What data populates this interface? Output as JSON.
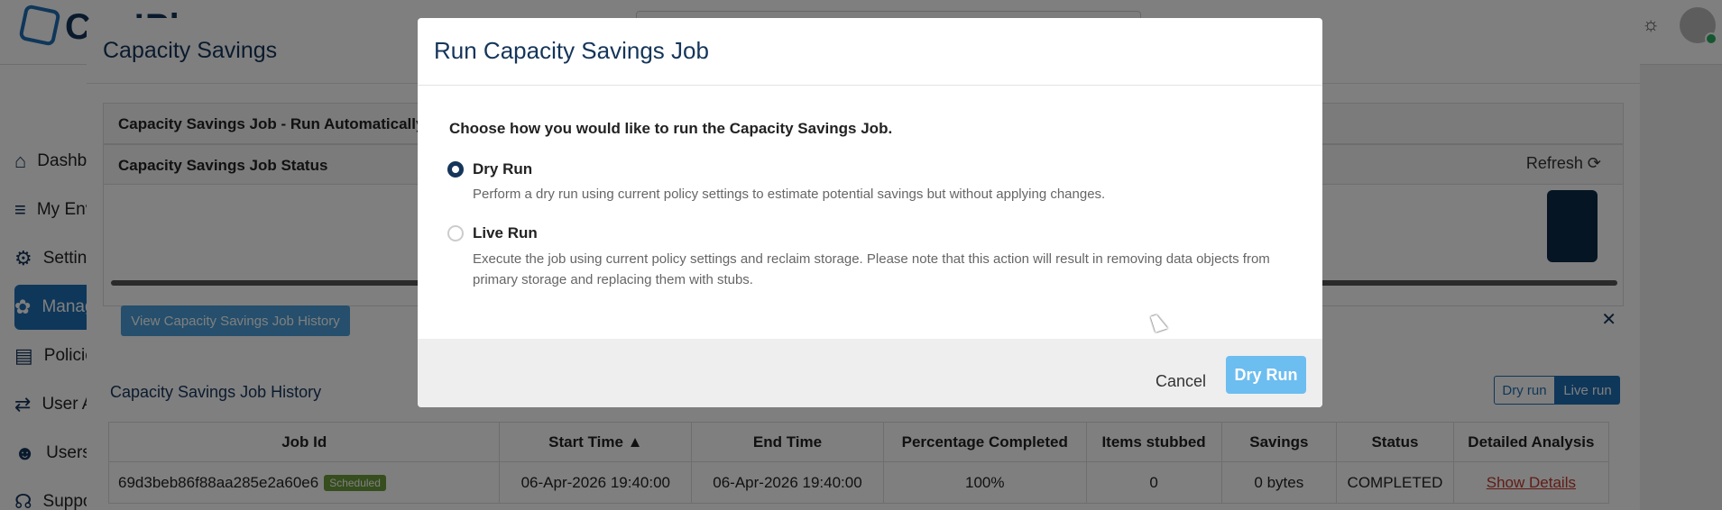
{
  "app": {
    "logo_text": "Cap!Pl",
    "sidebar": [
      {
        "label": "Dashboard",
        "icon": "home-icon",
        "glyph": "⌂"
      },
      {
        "label": "My Environment",
        "icon": "database-icon",
        "glyph": "≡"
      },
      {
        "label": "Settings",
        "icon": "gear-icon",
        "glyph": "⚙"
      },
      {
        "label": "Manage",
        "icon": "cluster-icon",
        "glyph": "✿"
      },
      {
        "label": "Policies",
        "icon": "document-icon",
        "glyph": "▤"
      },
      {
        "label": "User Activity",
        "icon": "arrows-icon",
        "glyph": "⇄"
      },
      {
        "label": "Users",
        "icon": "users-icon",
        "glyph": "☻"
      },
      {
        "label": "Support",
        "icon": "headset-icon",
        "glyph": "☊"
      }
    ]
  },
  "panel": {
    "title": "Capacity Savings",
    "card1_title": "Capacity Savings Job - Run Automatically",
    "card2_title": "Capacity Savings Job Status",
    "refresh_label": "Refresh",
    "history_button": "View Capacity Savings Job History",
    "history_title": "Capacity Savings Job History",
    "toggle_dry": "Dry run",
    "toggle_live": "Live run",
    "table": {
      "headers": [
        "Job Id",
        "Start Time ▲",
        "End Time",
        "Percentage Completed",
        "Items stubbed",
        "Savings",
        "Status",
        "Detailed Analysis"
      ],
      "row": {
        "job_id": "69d3beb86f88aa285e2a60e6",
        "badge": "Scheduled",
        "start": "06-Apr-2026 19:40:00",
        "end": "06-Apr-2026 19:40:00",
        "percent": "100%",
        "stubbed": "0",
        "savings": "0 bytes",
        "status": "COMPLETED",
        "details": "Show Details"
      }
    }
  },
  "modal": {
    "title": "Run Capacity Savings Job",
    "prompt": "Choose how you would like to run the Capacity Savings Job.",
    "options": [
      {
        "label": "Dry Run",
        "description": "Perform a dry run using current policy settings to estimate potential savings but without applying changes.",
        "selected": true
      },
      {
        "label": "Live Run",
        "description": "Execute the job using current policy settings and reclaim storage. Please note that this action will result in removing data objects from primary storage and replacing them with stubs.",
        "selected": false
      }
    ],
    "cancel_label": "Cancel",
    "confirm_label": "Dry Run"
  },
  "colors": {
    "brand": "#15355a",
    "accent": "#1f6fb5",
    "primary_button": "#6cbdf0"
  }
}
